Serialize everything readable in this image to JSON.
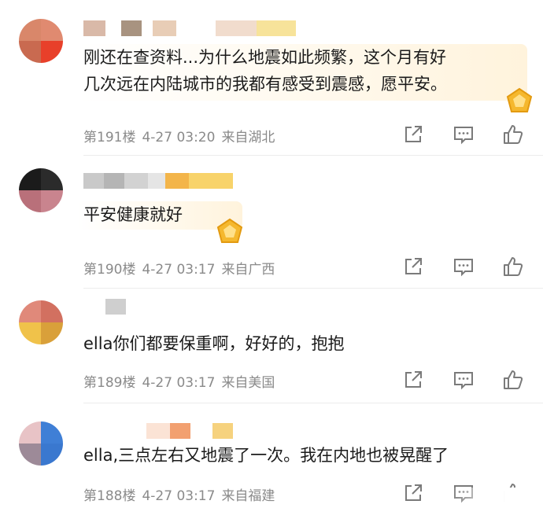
{
  "comments": [
    {
      "text_lines": [
        "刚还在查资料...为什么地震如此频繁，这个月有好",
        "几次远在内陆城市的我都有感受到震感，愿平安。"
      ],
      "floor": "第191楼",
      "time": "4-27 03:20",
      "location": "来自湖北"
    },
    {
      "text_lines": [
        "平安健康就好"
      ],
      "floor": "第190楼",
      "time": "4-27 03:17",
      "location": "来自广西"
    },
    {
      "text_lines": [
        "ella你们都要保重啊，好好的，抱抱"
      ],
      "floor": "第189楼",
      "time": "4-27 03:17",
      "location": "来自美国"
    },
    {
      "text_lines": [
        "ella,三点左右又地震了一次。我在内地也被晃醒了"
      ],
      "floor": "第188楼",
      "time": "4-27 03:17",
      "location": "来自福建"
    }
  ],
  "icons": {
    "share": "share-icon",
    "comment": "comment-icon",
    "like": "like-icon",
    "badge": "gold-badge-icon"
  },
  "colors": {
    "meta_text": "#8a8a8a",
    "icon_stroke": "#7a7a7a",
    "badge": "#f5b82e"
  }
}
